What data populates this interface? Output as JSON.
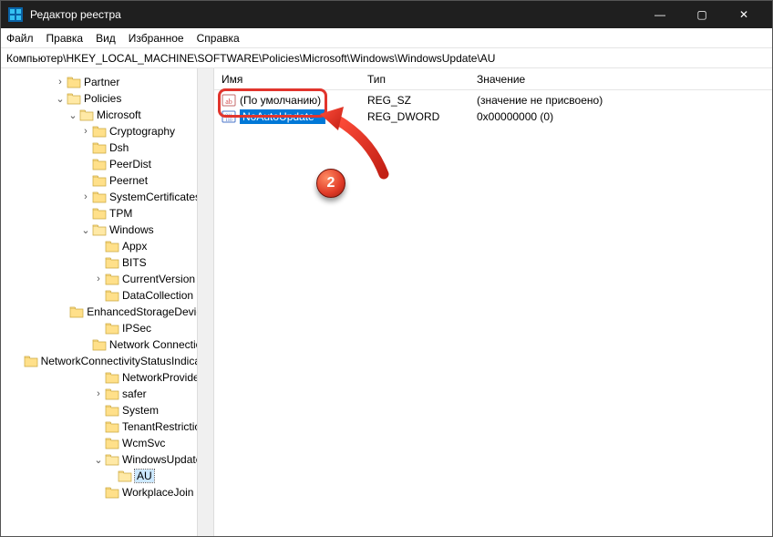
{
  "window": {
    "title": "Редактор реестра",
    "controls": {
      "min": "—",
      "max": "▢",
      "close": "✕"
    }
  },
  "menu": {
    "file": "Файл",
    "edit": "Правка",
    "view": "Вид",
    "favorites": "Избранное",
    "help": "Справка"
  },
  "address": "Компьютер\\HKEY_LOCAL_MACHINE\\SOFTWARE\\Policies\\Microsoft\\Windows\\WindowsUpdate\\AU",
  "columns": {
    "name": "Имя",
    "type": "Тип",
    "data": "Значение"
  },
  "values": [
    {
      "name": "(По умолчанию)",
      "kind": "sz",
      "type": "REG_SZ",
      "data": "(значение не присвоено)"
    },
    {
      "name": "NoAutoUpdate",
      "kind": "dword",
      "type": "REG_DWORD",
      "data": "0x00000000 (0)",
      "editing": true
    }
  ],
  "tree": [
    {
      "depth": 4,
      "toggle": ">",
      "label": "Partner"
    },
    {
      "depth": 4,
      "toggle": "v",
      "label": "Policies"
    },
    {
      "depth": 5,
      "toggle": "v",
      "label": "Microsoft"
    },
    {
      "depth": 6,
      "toggle": ">",
      "label": "Cryptography"
    },
    {
      "depth": 6,
      "toggle": "",
      "label": "Dsh"
    },
    {
      "depth": 6,
      "toggle": "",
      "label": "PeerDist"
    },
    {
      "depth": 6,
      "toggle": "",
      "label": "Peernet"
    },
    {
      "depth": 6,
      "toggle": ">",
      "label": "SystemCertificates"
    },
    {
      "depth": 6,
      "toggle": "",
      "label": "TPM"
    },
    {
      "depth": 6,
      "toggle": "v",
      "label": "Windows"
    },
    {
      "depth": 7,
      "toggle": "",
      "label": "Appx"
    },
    {
      "depth": 7,
      "toggle": "",
      "label": "BITS"
    },
    {
      "depth": 7,
      "toggle": ">",
      "label": "CurrentVersion"
    },
    {
      "depth": 7,
      "toggle": "",
      "label": "DataCollection"
    },
    {
      "depth": 7,
      "toggle": "",
      "label": "EnhancedStorageDevices"
    },
    {
      "depth": 7,
      "toggle": "",
      "label": "IPSec"
    },
    {
      "depth": 7,
      "toggle": "",
      "label": "Network Connections"
    },
    {
      "depth": 7,
      "toggle": "",
      "label": "NetworkConnectivityStatusIndicator"
    },
    {
      "depth": 7,
      "toggle": "",
      "label": "NetworkProvider"
    },
    {
      "depth": 7,
      "toggle": ">",
      "label": "safer"
    },
    {
      "depth": 7,
      "toggle": "",
      "label": "System"
    },
    {
      "depth": 7,
      "toggle": "",
      "label": "TenantRestrictions"
    },
    {
      "depth": 7,
      "toggle": "",
      "label": "WcmSvc"
    },
    {
      "depth": 7,
      "toggle": "v",
      "label": "WindowsUpdate"
    },
    {
      "depth": 8,
      "toggle": "",
      "label": "AU",
      "selected": true
    },
    {
      "depth": 7,
      "toggle": "",
      "label": "WorkplaceJoin"
    }
  ],
  "annotation": {
    "step": "2"
  }
}
